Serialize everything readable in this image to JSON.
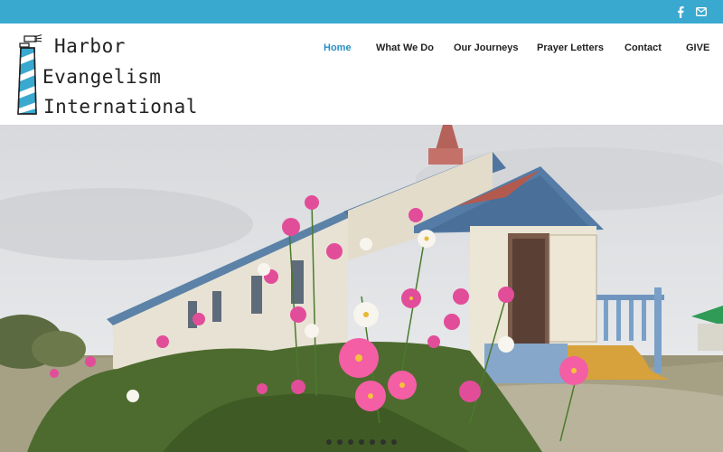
{
  "social": {
    "facebook_icon": "facebook-icon",
    "email_icon": "mail-icon"
  },
  "logo": {
    "line1": "Harbor",
    "line2": "Evangelism",
    "line3": "International",
    "icon": "lighthouse-icon"
  },
  "nav": [
    {
      "label": "Home",
      "active": true
    },
    {
      "label": "What We Do",
      "active": false
    },
    {
      "label": "Our Journeys",
      "active": false
    },
    {
      "label": "Prayer Letters",
      "active": false
    },
    {
      "label": "Contact",
      "active": false
    },
    {
      "label": "GIVE",
      "active": false
    }
  ],
  "colors": {
    "topbar": "#3aa9cf",
    "nav_active": "#2a8fc4",
    "nav_text": "#222222"
  },
  "slider": {
    "slide_count": 7,
    "current_slide": 1
  }
}
